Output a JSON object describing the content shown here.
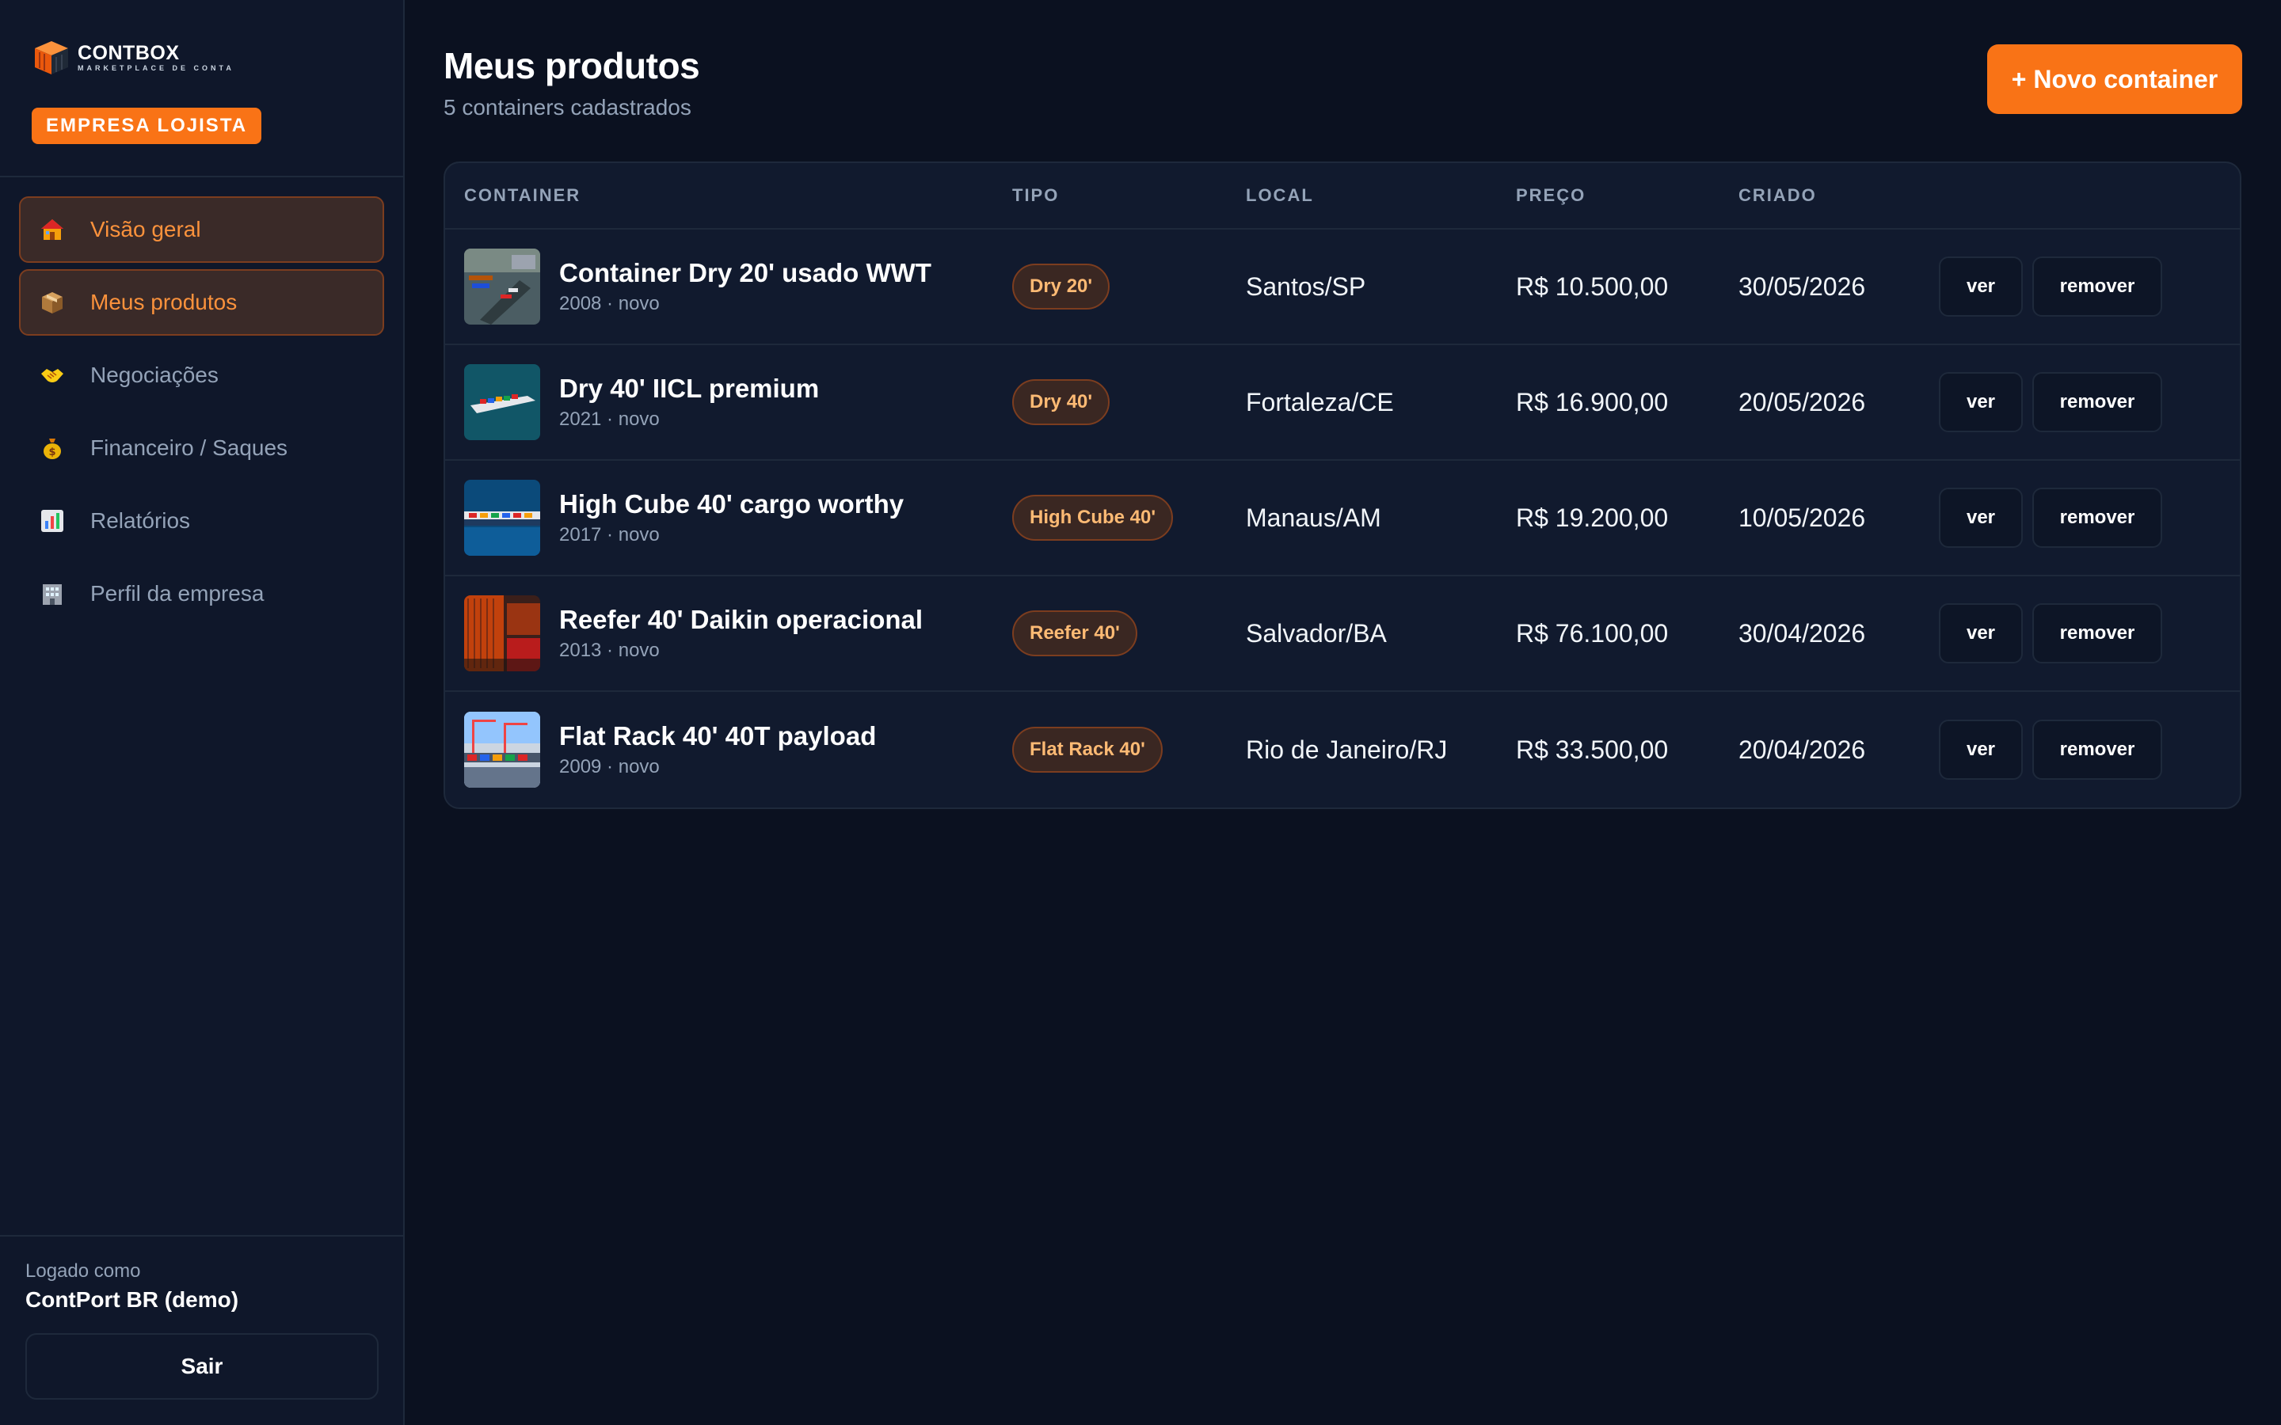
{
  "brand": {
    "name": "CONTBOX",
    "tagline": "MARKETPLACE DE CONTAINERS",
    "role_badge": "EMPRESA LOJISTA"
  },
  "sidebar": {
    "items": [
      {
        "label": "Visão geral",
        "icon": "house-icon"
      },
      {
        "label": "Meus produtos",
        "icon": "package-icon"
      },
      {
        "label": "Negociações",
        "icon": "handshake-icon"
      },
      {
        "label": "Financeiro / Saques",
        "icon": "money-bag-icon"
      },
      {
        "label": "Relatórios",
        "icon": "bar-chart-icon"
      },
      {
        "label": "Perfil da empresa",
        "icon": "office-building-icon"
      }
    ],
    "footer": {
      "logged_label": "Logado como",
      "user": "ContPort BR (demo)",
      "logout_label": "Sair"
    }
  },
  "header": {
    "title": "Meus produtos",
    "subtitle": "5 containers cadastrados",
    "new_button": "+ Novo container"
  },
  "table": {
    "columns": [
      "CONTAINER",
      "TIPO",
      "LOCAL",
      "PREÇO",
      "CRIADO"
    ],
    "rows": [
      {
        "name": "Container Dry 20' usado WWT",
        "meta": "2008 · novo",
        "tipo": "Dry 20'",
        "local": "Santos/SP",
        "preco": "R$ 10.500,00",
        "criado": "30/05/2026",
        "ver": "ver",
        "remover": "remover"
      },
      {
        "name": "Dry 40' IICL premium",
        "meta": "2021 · novo",
        "tipo": "Dry 40'",
        "local": "Fortaleza/CE",
        "preco": "R$ 16.900,00",
        "criado": "20/05/2026",
        "ver": "ver",
        "remover": "remover"
      },
      {
        "name": "High Cube 40' cargo worthy",
        "meta": "2017 · novo",
        "tipo": "High Cube 40'",
        "local": "Manaus/AM",
        "preco": "R$ 19.200,00",
        "criado": "10/05/2026",
        "ver": "ver",
        "remover": "remover"
      },
      {
        "name": "Reefer 40' Daikin operacional",
        "meta": "2013 · novo",
        "tipo": "Reefer 40'",
        "local": "Salvador/BA",
        "preco": "R$ 76.100,00",
        "criado": "30/04/2026",
        "ver": "ver",
        "remover": "remover"
      },
      {
        "name": "Flat Rack 40' 40T payload",
        "meta": "2009 · novo",
        "tipo": "Flat Rack 40'",
        "local": "Rio de Janeiro/RJ",
        "preco": "R$ 33.500,00",
        "criado": "20/04/2026",
        "ver": "ver",
        "remover": "remover"
      }
    ]
  },
  "colors": {
    "accent": "#f97316",
    "background": "#0b1120",
    "sidebar": "#0f172a",
    "card": "#111a2e"
  }
}
